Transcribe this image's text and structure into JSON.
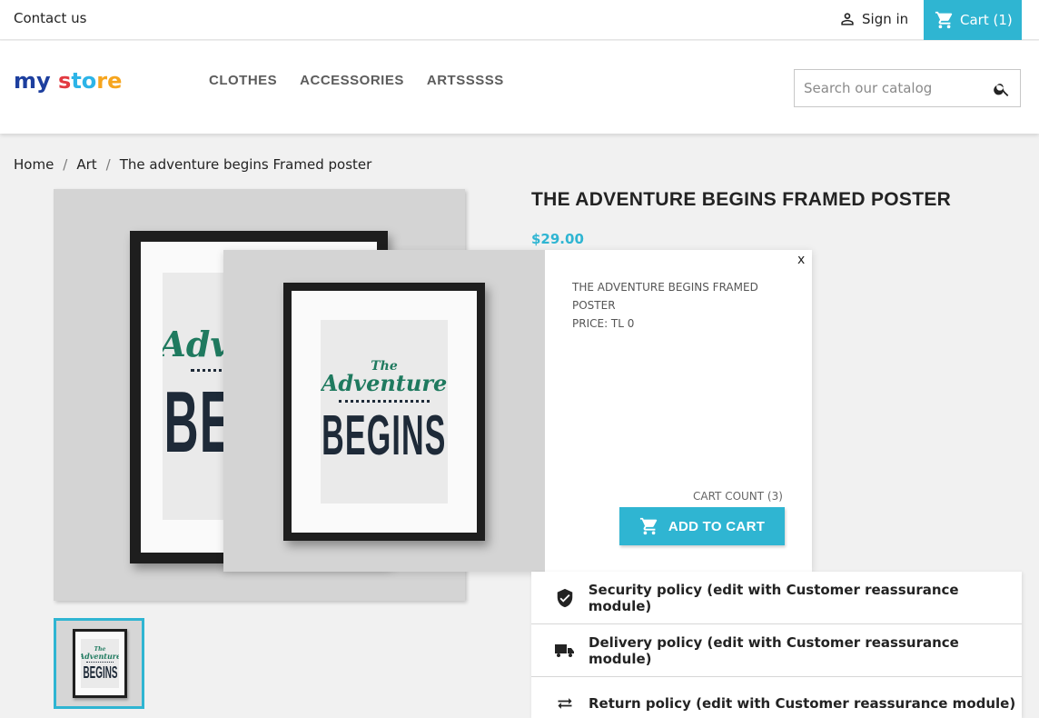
{
  "topbar": {
    "contact": "Contact us",
    "signin": "Sign in",
    "cart": "Cart (1)"
  },
  "header": {
    "logo_parts": [
      "my ",
      "s",
      "to",
      "re"
    ],
    "nav": [
      "CLOTHES",
      "ACCESSORIES",
      "ARTSSSSS"
    ],
    "search_placeholder": "Search our catalog"
  },
  "breadcrumb": [
    "Home",
    "Art",
    "The adventure begins Framed poster"
  ],
  "product": {
    "title": "THE ADVENTURE BEGINS FRAMED POSTER",
    "price": "$29.00"
  },
  "poster": {
    "the": "The",
    "adventure": "Adventure",
    "begins": "BEGINS"
  },
  "popup": {
    "close": "x",
    "name_line1": "THE ADVENTURE BEGINS FRAMED",
    "name_line2": "POSTER",
    "price": "PRICE: TL 0",
    "cart_count": "CART COUNT (3)",
    "add_to_cart": "ADD TO CART"
  },
  "reassurance": [
    {
      "icon": "shield-icon",
      "label": "Security policy (edit with Customer reassurance module)"
    },
    {
      "icon": "truck-icon",
      "label": "Delivery policy (edit with Customer reassurance module)"
    },
    {
      "icon": "swap-arrows-icon",
      "label": "Return policy (edit with Customer reassurance module)"
    }
  ],
  "colors": {
    "accent": "#2fb5d2",
    "background": "#f1f1f1",
    "poster_green": "#1f7a5f",
    "poster_navy": "#1e2a38"
  }
}
